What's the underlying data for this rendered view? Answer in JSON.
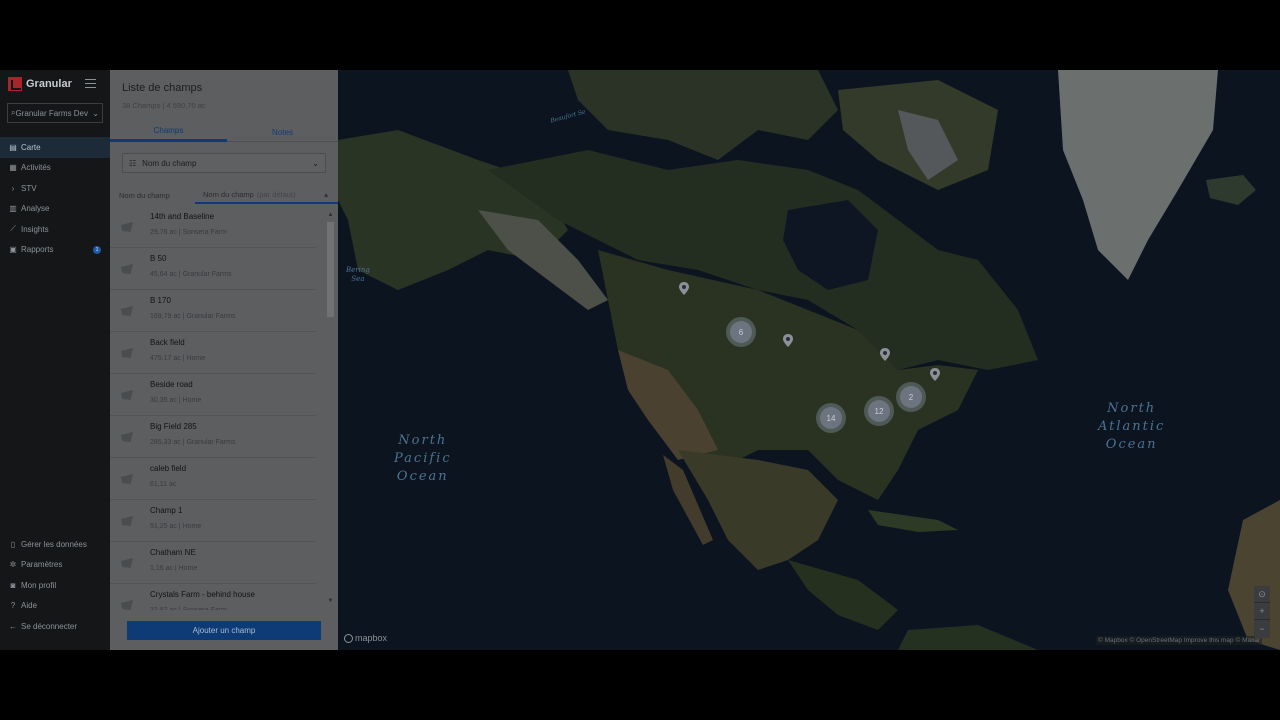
{
  "sidebar": {
    "brand": "Granular",
    "farm_select": "Granular Farms Dev",
    "nav": [
      {
        "label": "Carte",
        "icon": "map-icon",
        "active": true
      },
      {
        "label": "Activités",
        "icon": "calendar-icon"
      },
      {
        "label": "STV",
        "icon": "chevron-icon"
      },
      {
        "label": "Analyse",
        "icon": "bar-chart-icon"
      },
      {
        "label": "Insights",
        "icon": "trend-icon"
      },
      {
        "label": "Rapports",
        "icon": "document-icon",
        "badge": "1"
      }
    ],
    "bottom": [
      {
        "label": "Gérer les données",
        "icon": "phone-icon"
      },
      {
        "label": "Paramètres",
        "icon": "gear-icon"
      },
      {
        "label": "Mon profil",
        "icon": "user-icon"
      },
      {
        "label": "Aide",
        "icon": "help-icon"
      },
      {
        "label": "Se déconnecter",
        "icon": "logout-icon"
      }
    ]
  },
  "panel": {
    "title": "Liste de champs",
    "subtitle": "38 Champs | 4 590,70 ac",
    "tabs": [
      "Champs",
      "Notes"
    ],
    "filter": "Nom du champ",
    "sort_a": "Nom du champ",
    "sort_b": "Nom du champ",
    "sort_b_hint": "(par défaut)",
    "fields": [
      {
        "name": "14th and Baseline",
        "sub": "29,76 ac | Sonsera Farm"
      },
      {
        "name": "B 50",
        "sub": "45,64 ac | Granular Farms"
      },
      {
        "name": "B 170",
        "sub": "169,79 ac | Granular Farms"
      },
      {
        "name": "Back field",
        "sub": "475,17 ac | Home"
      },
      {
        "name": "Beside road",
        "sub": "30,35 ac | Home"
      },
      {
        "name": "Big Field 285",
        "sub": "285,33 ac | Granular Farms"
      },
      {
        "name": "caleb field",
        "sub": "61,11 ac"
      },
      {
        "name": "Champ 1",
        "sub": "51,25 ac | Home"
      },
      {
        "name": "Chatham NE",
        "sub": "1,16 ac | Home"
      },
      {
        "name": "Crystals Farm - behind house",
        "sub": "32,97 ac | Sonsera Farm"
      }
    ],
    "add_button": "Ajouter un champ"
  },
  "map": {
    "labels": {
      "north_pacific": "North\nPacific\nOcean",
      "north_atlantic": "North\nAtlantic\nOcean",
      "bering": "Bering\nSea",
      "beaufort": "Beaufort Se"
    },
    "clusters": [
      "6",
      "14",
      "12",
      "2"
    ],
    "mapbox": "mapbox",
    "attribution": "© Mapbox © OpenStreetMap Improve this map © Maxar",
    "zoom_in": "+",
    "zoom_out": "−",
    "compass": "⊙"
  }
}
